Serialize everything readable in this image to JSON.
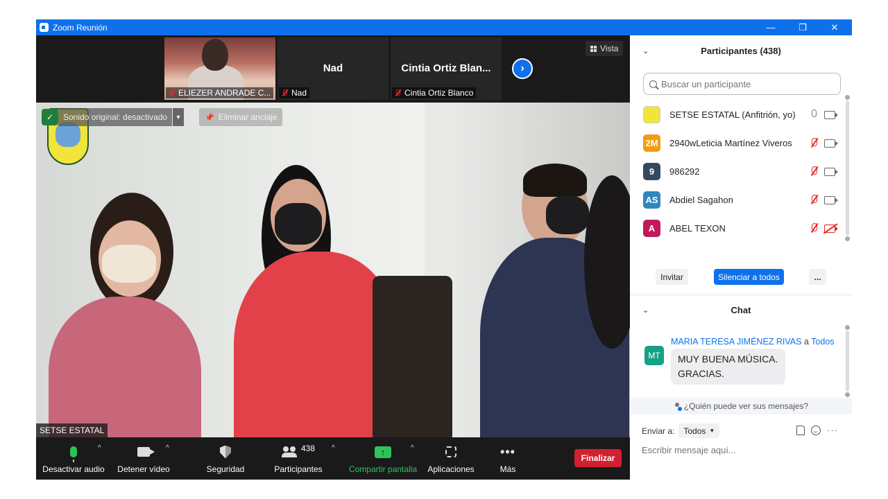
{
  "window": {
    "title": "Zoom Reunión",
    "controls": {
      "minimize": "—",
      "restore": "❐",
      "close": "✕"
    }
  },
  "gallery": {
    "thumbnails": [
      {
        "label": "ELIEZER ANDRADE C...",
        "center_name": "",
        "has_video": true
      },
      {
        "label": "Nad",
        "center_name": "Nad",
        "has_video": false
      },
      {
        "label": "Cintia Ortiz Blanco",
        "center_name": "Cintia  Ortiz  Blan...",
        "has_video": false
      }
    ],
    "next_icon": "chevron-right-icon",
    "view_label": "Vista"
  },
  "main_video": {
    "audio_status": "Sonido original: desactivado",
    "unpin_label": "Eliminar anclaje",
    "speaker_name": "SETSE ESTATAL"
  },
  "toolbar": {
    "mute_label": "Desactivar audio",
    "video_label": "Detener vídeo",
    "security_label": "Seguridad",
    "participants_label": "Participantes",
    "participants_count": "438",
    "share_label": "Compartir pantalla",
    "apps_label": "Aplicaciones",
    "more_label": "Más",
    "end_label": "Finalizar"
  },
  "participants_panel": {
    "title": "Participantes (438)",
    "search_placeholder": "Buscar un participante",
    "items": [
      {
        "initials": "",
        "name": "SETSE ESTATAL (Anfitrión, yo)",
        "avatar_color": "#ffffff",
        "mic": "on",
        "cam": "on"
      },
      {
        "initials": "2M",
        "name": "2940wLeticia Martínez Viveros",
        "avatar_color": "#f39c12",
        "mic": "off",
        "cam": "on"
      },
      {
        "initials": "9",
        "name": "986292",
        "avatar_color": "#34495e",
        "mic": "off",
        "cam": "on"
      },
      {
        "initials": "AS",
        "name": "Abdiel Sagahon",
        "avatar_color": "#2e86c1",
        "mic": "off",
        "cam": "on"
      },
      {
        "initials": "A",
        "name": "ABEL TEXON",
        "avatar_color": "#c2185b",
        "mic": "off",
        "cam": "off"
      }
    ],
    "invite_label": "Invitar",
    "mute_all_label": "Silenciar a todos",
    "more_label": "..."
  },
  "chat_panel": {
    "title": "Chat",
    "message": {
      "initials": "MT",
      "sender": "MARIA TERESA JIMÉNEZ RIVAS",
      "connector": "a",
      "recipient": "Todos",
      "line1": "MUY BUENA MÚSICA.",
      "line2": "GRACIAS."
    },
    "who_can_see": "¿Quién puede ver sus mensajes?",
    "send_to_label": "Enviar a:",
    "send_to_value": "Todos",
    "input_placeholder": "Escribir mensaje aquí..."
  },
  "colors": {
    "zoom_blue": "#0e71eb",
    "end_red": "#d32030",
    "share_green": "#2ec35a",
    "muted_red": "#e02828"
  }
}
